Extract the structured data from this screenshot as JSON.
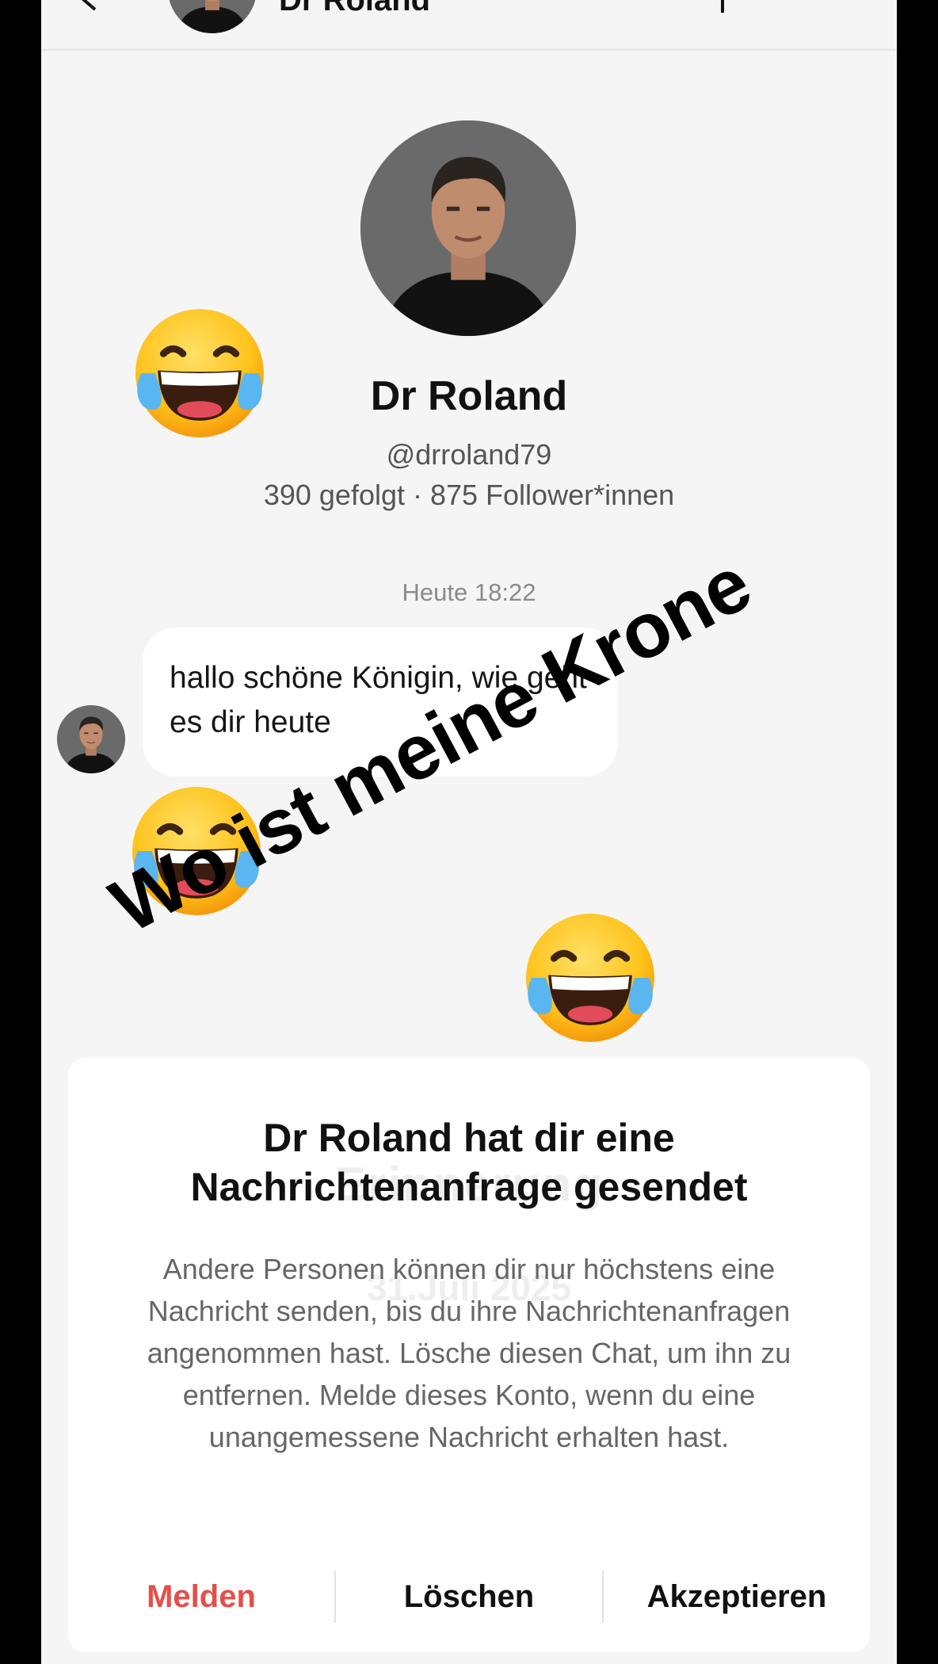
{
  "header": {
    "name": "Dr Roland"
  },
  "profile": {
    "name": "Dr Roland",
    "handle": "@drroland79",
    "stats": "390 gefolgt · 875 Follower*innen"
  },
  "chat": {
    "timestamp": "Heute 18:22",
    "message": "hallo schöne Königin, wie geht es dir heute"
  },
  "overlay": {
    "caption": "Wo ist meine Krone",
    "emoji": "face-with-tears-of-joy"
  },
  "request_panel": {
    "title": "Dr Roland hat dir eine Nachrichtenanfrage gesendet",
    "body": "Andere Personen können dir nur höchstens eine Nachricht senden, bis du ihre Nachrichtenanfragen angenommen hast. Lösche diesen Chat, um ihn zu entfernen. Melde dieses Konto, wenn du eine unangemessene Nachricht erhalten hast.",
    "watermark": "Erinnerung",
    "watermark_date": "31.Juli 2025",
    "actions": {
      "report": "Melden",
      "delete": "Löschen",
      "accept": "Akzeptieren"
    }
  },
  "colors": {
    "report_red": "#e2504a",
    "background": "#f5f5f5"
  }
}
